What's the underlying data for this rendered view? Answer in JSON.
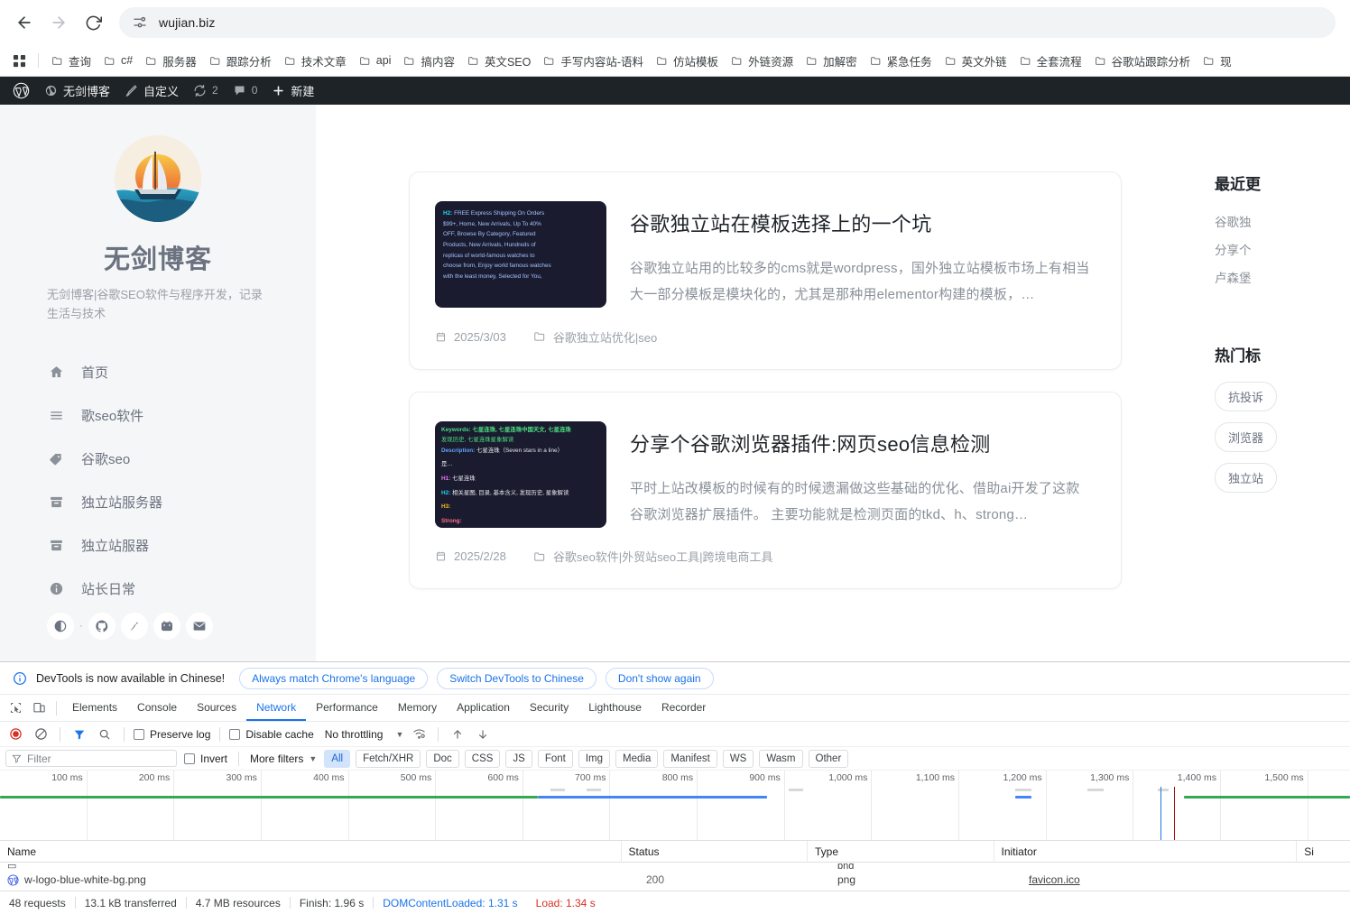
{
  "browser": {
    "url": "wujian.biz",
    "nav": {
      "back": "back-arrow",
      "forward": "forward-arrow",
      "reload": "reload"
    },
    "bookmarks": [
      "查询",
      "c#",
      "服务器",
      "跟踪分析",
      "技术文章",
      "api",
      "搞内容",
      "英文SEO",
      "手写内容站-语料",
      "仿站模板",
      "外链资源",
      "加解密",
      "紧急任务",
      "英文外链",
      "全套流程",
      "谷歌站跟踪分析",
      "现"
    ]
  },
  "adminbar": {
    "site_name": "无剑博客",
    "customize": "自定义",
    "updates_count": "2",
    "comments_count": "0",
    "new": "新建"
  },
  "blog": {
    "brand_title": "无剑博客",
    "brand_desc": "无剑博客|谷歌SEO软件与程序开发，记录生活与技术",
    "nav": [
      {
        "label": "首页",
        "icon": "home-icon"
      },
      {
        "label": "歌seo软件",
        "icon": "list-icon"
      },
      {
        "label": "谷歌seo",
        "icon": "tag-icon"
      },
      {
        "label": "独立站服务器",
        "icon": "archive-icon"
      },
      {
        "label": "独立站服器",
        "icon": "archive-icon"
      },
      {
        "label": "站长日常",
        "icon": "info-icon"
      }
    ],
    "social": [
      {
        "name": "theme-toggle-icon"
      },
      {
        "name": "github-icon"
      },
      {
        "name": "steam-icon"
      },
      {
        "name": "bilibili-icon"
      },
      {
        "name": "email-icon"
      }
    ],
    "posts": [
      {
        "title": "谷歌独立站在模板选择上的一个坑",
        "excerpt": "谷歌独立站用的比较多的cms就是wordpress，国外独立站模板市场上有相当大一部分模板是模块化的，尤其是那种用elementor构建的模板，…",
        "date": "2025/3/03",
        "category": "谷歌独立站优化|seo",
        "thumb_type": "seo-h2-list",
        "thumb_lines": [
          {
            "label": "H2:",
            "text": " FREE Express Shipping On Orders"
          },
          {
            "label": "",
            "text": "$99+, Home, New Arrivals, Up To 40%"
          },
          {
            "label": "",
            "text": "OFF, Browse By Category, Featured"
          },
          {
            "label": "",
            "text": "Products, New Arrivals, Hundreds of"
          },
          {
            "label": "",
            "text": "replicas of world-famous watches to"
          },
          {
            "label": "",
            "text": "choose from, Enjoy world famous watches"
          },
          {
            "label": "",
            "text": "with the least money, Selected for You,"
          }
        ]
      },
      {
        "title": "分享个谷歌浏览器插件:网页seo信息检测",
        "excerpt": "平时上站改模板的时候有的时候遗漏做这些基础的优化、借助ai开发了这款谷歌浏览器扩展插件。 主要功能就是检测页面的tkd、h、strong…",
        "date": "2025/2/28",
        "category": "谷歌seo软件|外贸站seo工具|跨境电商工具",
        "thumb_type": "seo-inspector",
        "thumb_rows": [
          {
            "label": "Keywords:",
            "label_color": "kw",
            "value": "七星连珠, 七星连珠中国天文, 七星连珠"
          },
          {
            "label": "",
            "label_color": "kwv",
            "value": "发现历史, 七星连珠星象解读"
          },
          {
            "label": "Description:",
            "label_color": "desc",
            "value": "七星连珠（Seven stars in a line）"
          },
          {
            "label": "",
            "label_color": "desc",
            "value": "是…"
          },
          {
            "label": "H1:",
            "label_color": "h1",
            "value": "七星连珠"
          },
          {
            "label": "H2:",
            "label_color": "h2",
            "value": "相关星图, 目录, 基本含义, 发现历史, 星象解读"
          },
          {
            "label": "H3:",
            "label_color": "h3",
            "value": ""
          },
          {
            "label": "Strong:",
            "label_color": "strong",
            "value": ""
          }
        ]
      }
    ],
    "right_widgets": [
      {
        "title": "最近更",
        "links": [
          "谷歌独",
          "分享个",
          "卢森堡"
        ]
      },
      {
        "title": "热门标",
        "tags": [
          "抗投诉",
          "浏览器",
          "独立站"
        ]
      }
    ]
  },
  "devtools": {
    "banner": {
      "message": "DevTools is now available in Chinese!",
      "buttons": [
        "Always match Chrome's language",
        "Switch DevTools to Chinese",
        "Don't show again"
      ]
    },
    "tabs": [
      "Elements",
      "Console",
      "Sources",
      "Network",
      "Performance",
      "Memory",
      "Application",
      "Security",
      "Lighthouse",
      "Recorder"
    ],
    "active_tab": "Network",
    "toolbar": {
      "preserve_log": "Preserve log",
      "disable_cache": "Disable cache",
      "throttling": "No throttling"
    },
    "filterbar": {
      "placeholder": "Filter",
      "invert": "Invert",
      "more_filters": "More filters",
      "types": [
        "All",
        "Fetch/XHR",
        "Doc",
        "CSS",
        "JS",
        "Font",
        "Img",
        "Media",
        "Manifest",
        "WS",
        "Wasm",
        "Other"
      ],
      "active_type": "All"
    },
    "overview": {
      "ticks": [
        "100 ms",
        "200 ms",
        "300 ms",
        "400 ms",
        "500 ms",
        "600 ms",
        "700 ms",
        "800 ms",
        "900 ms",
        "1,000 ms",
        "1,100 ms",
        "1,200 ms",
        "1,300 ms",
        "1,400 ms",
        "1,500 ms"
      ],
      "colors": {
        "green": "#34a853",
        "blue": "#4285f4",
        "dcl_line": "#1a73e8",
        "load_line": "#a50e0e"
      }
    },
    "table": {
      "columns": [
        "Name",
        "Status",
        "Type",
        "Initiator",
        "Si"
      ],
      "rows": [
        {
          "name": "w-logo-blue-white-bg.png",
          "status": "200",
          "type": "png",
          "initiator": "favicon.ico"
        }
      ]
    },
    "status": {
      "requests": "48 requests",
      "transferred": "13.1 kB transferred",
      "resources": "4.7 MB resources",
      "finish": "Finish: 1.96 s",
      "dcl": "DOMContentLoaded: 1.31 s",
      "load": "Load: 1.34 s"
    }
  }
}
